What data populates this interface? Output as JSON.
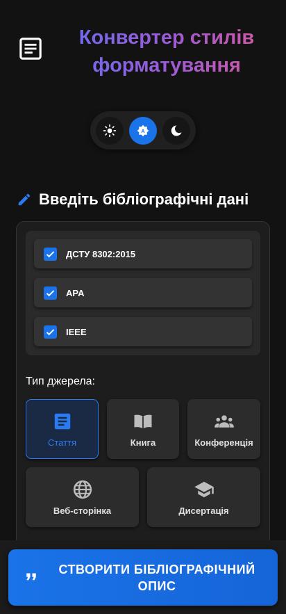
{
  "header": {
    "title": "Конвертер стилів форматування",
    "logo_icon": "article-icon"
  },
  "theme": {
    "options": [
      {
        "icon": "sun-icon",
        "active": false
      },
      {
        "icon": "auto-theme-icon",
        "active": true
      },
      {
        "icon": "moon-icon",
        "active": false
      }
    ]
  },
  "section": {
    "title": "Введіть бібліографічні дані",
    "icon": "pencil-icon"
  },
  "styles": {
    "items": [
      {
        "label": "ДСТУ 8302:2015",
        "checked": true
      },
      {
        "label": "APA",
        "checked": true
      },
      {
        "label": "IEEE",
        "checked": true
      }
    ]
  },
  "source_type": {
    "label": "Тип джерела:",
    "options": [
      {
        "label": "Стаття",
        "icon": "article-icon",
        "selected": true
      },
      {
        "label": "Книга",
        "icon": "book-icon",
        "selected": false
      },
      {
        "label": "Конференція",
        "icon": "group-icon",
        "selected": false
      },
      {
        "label": "Веб-сторінка",
        "icon": "globe-icon",
        "selected": false
      },
      {
        "label": "Дисертація",
        "icon": "graduation-cap-icon",
        "selected": false
      }
    ]
  },
  "submit": {
    "label": "СТВОРИТИ БІБЛІОГРАФІЧНИЙ ОПИС",
    "icon": "quote-icon"
  },
  "colors": {
    "accent": "#1a73e8",
    "background": "#121212",
    "title_gradient_start": "#6a6cf0",
    "title_gradient_end": "#d45aa0"
  }
}
